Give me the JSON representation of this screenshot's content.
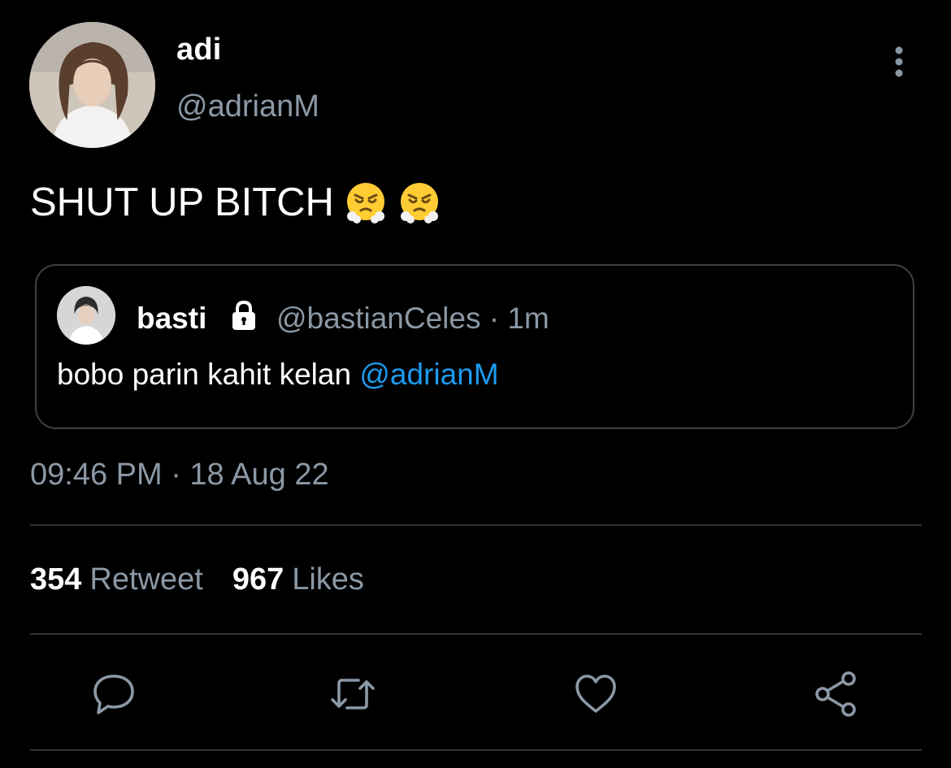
{
  "author": {
    "display_name": "adi",
    "handle": "@adrianM",
    "avatar_icon": "profile-photo"
  },
  "tweet": {
    "text": "SHUT UP BITCH",
    "emojis": [
      "face-with-steam-from-nose",
      "face-with-steam-from-nose"
    ],
    "timestamp": "09:46 PM · 18 Aug 22"
  },
  "quoted": {
    "display_name": "basti",
    "protected_icon": "lock-icon",
    "handle_time": "@bastianCeles · 1m",
    "text": "bobo parin kahit kelan ",
    "mention": "@adrianM"
  },
  "stats": {
    "retweet_count": "354",
    "retweet_label": "Retweet",
    "like_count": "967",
    "like_label": "Likes"
  },
  "actions": [
    "reply-icon",
    "retweet-icon",
    "like-icon",
    "share-icon"
  ],
  "colors": {
    "background": "#000000",
    "primary_text": "#ffffff",
    "secondary_text": "#8b98a5",
    "link": "#1d9bf0",
    "border": "#2f3336"
  }
}
